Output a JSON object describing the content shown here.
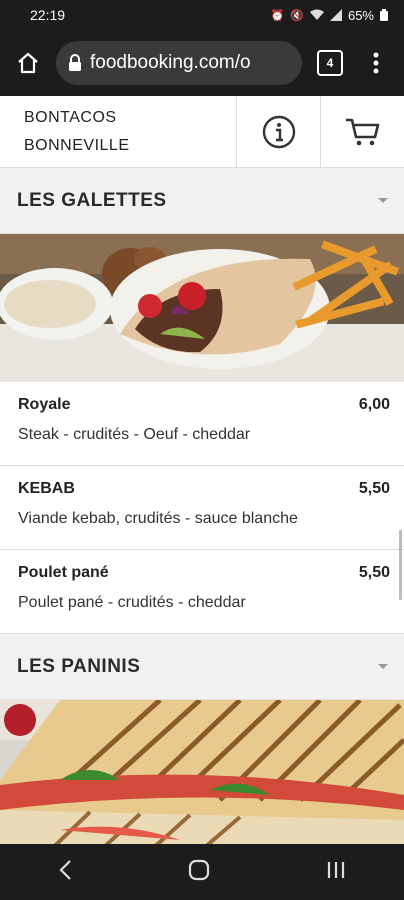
{
  "status_bar": {
    "time": "22:19",
    "battery": "65%"
  },
  "browser": {
    "url": "foodbooking.com/o",
    "tab_count": "4"
  },
  "header": {
    "restaurant_line1": "BONTACOS",
    "restaurant_line2": "BONNEVILLE"
  },
  "sections": [
    {
      "title": "LES GALETTES",
      "items": [
        {
          "name": "Royale",
          "price": "6,00",
          "description": "Steak - crudités - Oeuf - cheddar"
        },
        {
          "name": "KEBAB",
          "price": "5,50",
          "description": "Viande kebab, crudités - sauce blanche"
        },
        {
          "name": "Poulet pané",
          "price": "5,50",
          "description": "Poulet pané - crudités - cheddar"
        }
      ]
    },
    {
      "title": "LES PANINIS"
    }
  ],
  "colors": {
    "browser_dark": "#1c1c1c",
    "section_bg": "#f1f1f1"
  }
}
